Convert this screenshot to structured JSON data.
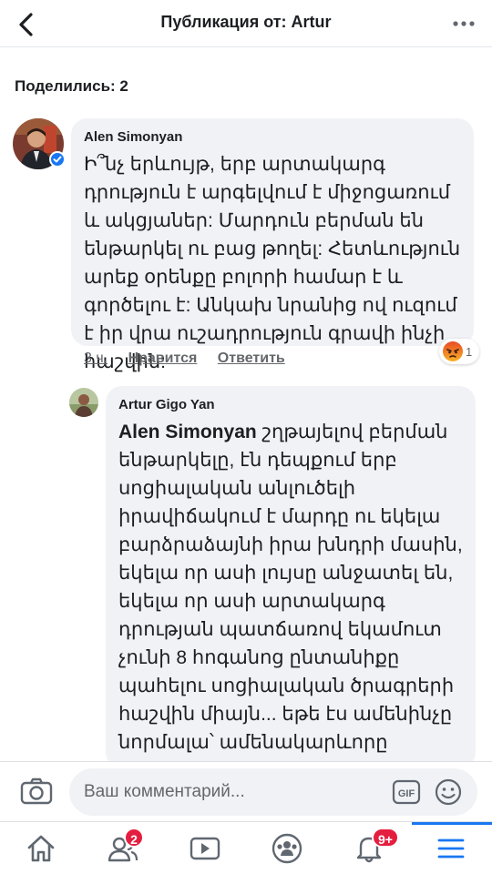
{
  "header": {
    "title": "Публикация от: Artur"
  },
  "shares": {
    "label": "Поделились: 2"
  },
  "comment1": {
    "author": "Alen Simonyan",
    "text": "Ի՞նչ երևույթ, երբ արտակարգ դրություն է արգելվում է միջոցառում և ակցյաներ: Մարդուն բերման են ենթարկել ու բաց թողել: Հետևություն արեք օրենքը բոլորի համար է և գործելու է: Անկախ նրանից ով ուզում է իր վրա ուշադրություն գրավի ինչի հաշվին:",
    "time": "3 ч.",
    "like": "Нравится",
    "reply": "Ответить",
    "reaction_count": "1",
    "reaction_icon": "angry-reaction-icon"
  },
  "comment2": {
    "author": "Artur Gigo Yan",
    "mention": "Alen Simonyan",
    "text": " շղթայելով բերման ենթարկելը, էն դեպքում երբ սոցիալական անլուծելի իրավիճակում է մարդը ու եկելա բարձրաձայնի իրա խնդրի մասին, եկելա որ ասի լույսը անջատել են, եկելա որ ասի արտակարգ դրության պատճառով եկամուտ չունի 8 հոգանոց ընտանիքը պահելու սոցիալական ծրագրերի հաշվին միայն... եթե էս ամենինչը նորմալա՝ ամենակարևորը ՇՂԹԱՅԵԼԸ, ուրեմ շատ լավ, հեռուստադիտողներն արժան"
  },
  "composer": {
    "placeholder": "Ваш комментарий..."
  },
  "nav": {
    "friends_badge": "2",
    "notifications_badge": "9+"
  },
  "colors": {
    "accent": "#1877f2",
    "badge": "#e41e3f",
    "bubble": "#f0f2f5"
  }
}
